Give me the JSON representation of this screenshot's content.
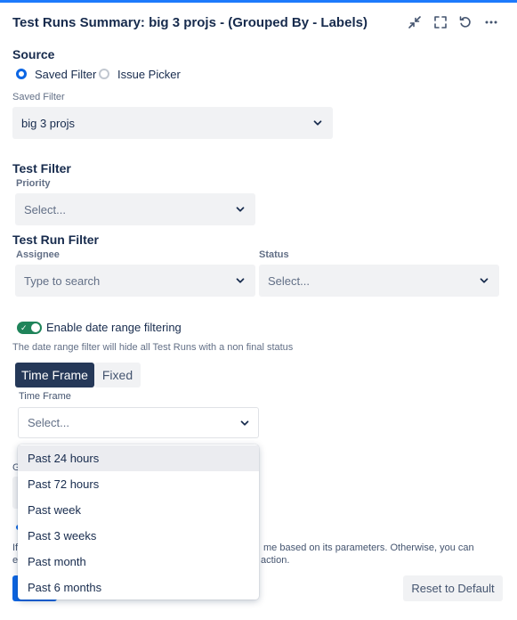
{
  "header": {
    "title": "Test Runs Summary: big 3 projs - (Grouped By - Labels)",
    "icons": [
      "collapse-icon",
      "fullscreen-icon",
      "refresh-icon",
      "more-icon"
    ]
  },
  "source": {
    "title": "Source",
    "options": [
      {
        "label": "Saved Filter",
        "checked": true
      },
      {
        "label": "Issue Picker",
        "checked": false
      }
    ],
    "saved_filter_label": "Saved Filter",
    "saved_filter_value": "big 3 projs"
  },
  "test_filter": {
    "title": "Test Filter",
    "priority_label": "Priority",
    "priority_placeholder": "Select..."
  },
  "test_run_filter": {
    "title": "Test Run Filter",
    "assignee_label": "Assignee",
    "assignee_placeholder": "Type to search",
    "status_label": "Status",
    "status_placeholder": "Select..."
  },
  "date_range": {
    "toggle_label": "Enable date range filtering",
    "toggle_on": true,
    "note": "The date range filter will hide all Test Runs with a non final status",
    "tabs": [
      {
        "label": "Time Frame",
        "active": true
      },
      {
        "label": "Fixed",
        "active": false
      }
    ],
    "time_frame_label": "Time Frame",
    "time_frame_placeholder": "Select...",
    "options": [
      "Past 24 hours",
      "Past 72 hours",
      "Past week",
      "Past 3 weeks",
      "Past month",
      "Past 6 months"
    ]
  },
  "partially_hidden": {
    "group_label_fragment": "G",
    "info_prefix_1": "If",
    "info_suffix_1": "me based on its parameters. Otherwise, you can",
    "info_prefix_2": "e",
    "info_suffix_2": "action."
  },
  "footer": {
    "reset_label": "Reset to Default"
  },
  "colors": {
    "accent": "#0c66e4",
    "toggle_on": "#1f845a",
    "active_tab": "#253858",
    "top_bar": "#1d7afc"
  }
}
